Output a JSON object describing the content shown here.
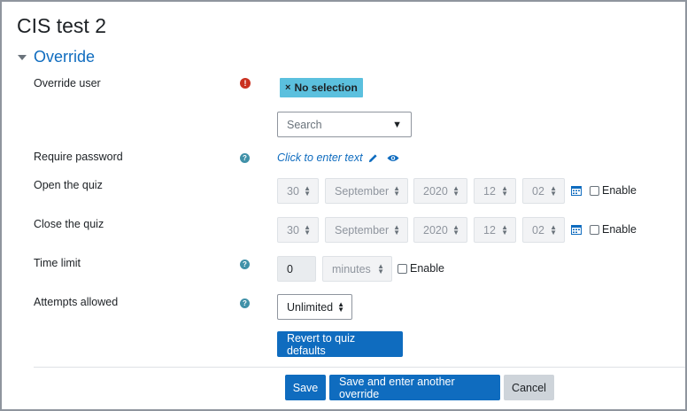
{
  "page_title": "CIS test 2",
  "section": {
    "title": "Override"
  },
  "override_user": {
    "label": "Override user",
    "selected_chip": "No selection",
    "chip_remove": "×",
    "search_placeholder": "Search",
    "dropdown_arrow": "▼"
  },
  "require_password": {
    "label": "Require password",
    "inplace_text": "Click to enter text"
  },
  "open_quiz": {
    "label": "Open the quiz",
    "day": "30",
    "month": "September",
    "year": "2020",
    "hour": "12",
    "minute": "02",
    "enable_label": "Enable"
  },
  "close_quiz": {
    "label": "Close the quiz",
    "day": "30",
    "month": "September",
    "year": "2020",
    "hour": "12",
    "minute": "02",
    "enable_label": "Enable"
  },
  "time_limit": {
    "label": "Time limit",
    "value": "0",
    "unit": "minutes",
    "enable_label": "Enable"
  },
  "attempts": {
    "label": "Attempts allowed",
    "value": "Unlimited"
  },
  "buttons": {
    "revert": "Revert to quiz defaults",
    "save": "Save",
    "save_another": "Save and enter another override",
    "cancel": "Cancel"
  },
  "colors": {
    "link_blue": "#0f6cbf",
    "chip_cyan": "#5bc0de",
    "required_red": "#ca3120",
    "help_teal": "#1f7e9a",
    "cancel_gray": "#ced4da"
  },
  "icons": {
    "required": "exclamation-circle-icon",
    "help": "question-circle-icon",
    "edit": "pencil-icon",
    "reveal": "eye-icon",
    "calendar": "calendar-icon",
    "caret": "caret-down-icon"
  }
}
